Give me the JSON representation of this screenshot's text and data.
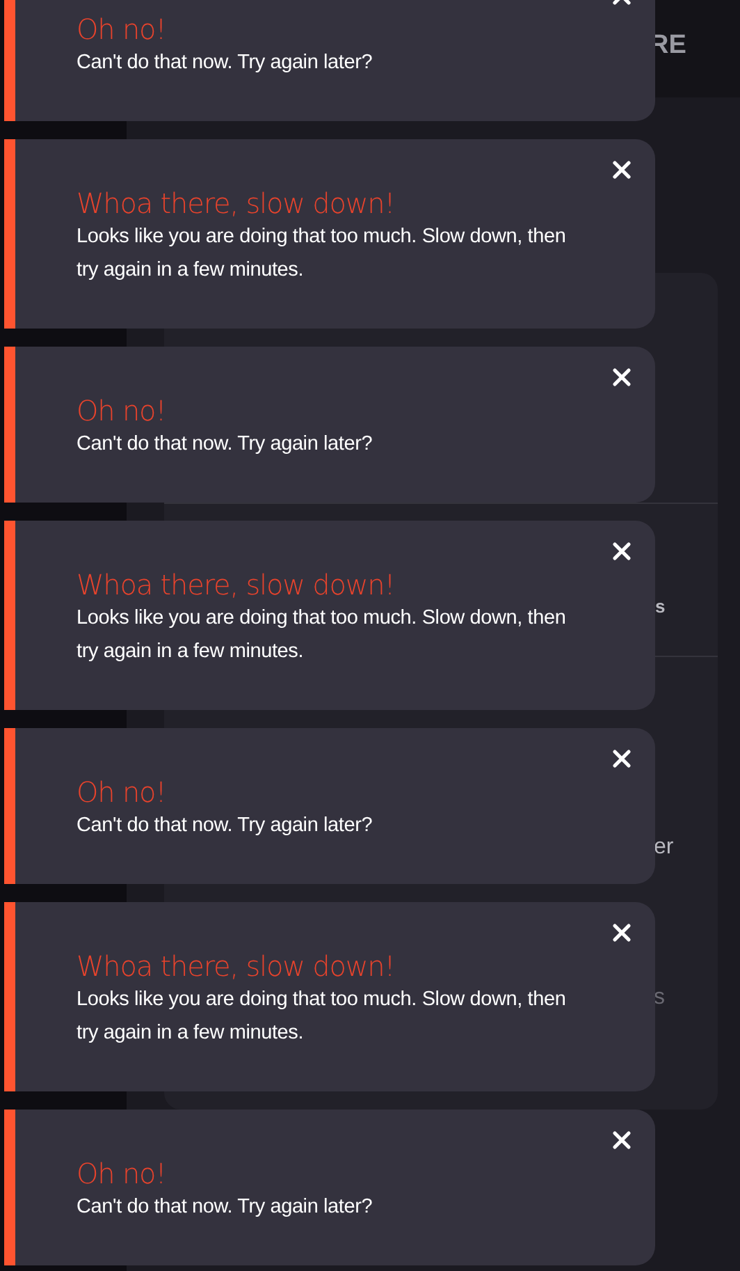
{
  "background": {
    "header_text": "RE",
    "texts": [
      {
        "text": "s"
      },
      {
        "text": "er"
      },
      {
        "text": "s"
      }
    ]
  },
  "toasts": [
    {
      "title": "Oh no!",
      "message": "Can't do that now. Try again later?"
    },
    {
      "title": "Whoa there, slow down!",
      "message": "Looks like you are doing that too much. Slow down, then try again in a few minutes."
    },
    {
      "title": "Oh no!",
      "message": "Can't do that now. Try again later?"
    },
    {
      "title": "Whoa there, slow down!",
      "message": "Looks like you are doing that too much. Slow down, then try again in a few minutes."
    },
    {
      "title": "Oh no!",
      "message": "Can't do that now. Try again later?"
    },
    {
      "title": "Whoa there, slow down!",
      "message": "Looks like you are doing that too much. Slow down, then try again in a few minutes."
    },
    {
      "title": "Oh no!",
      "message": "Can't do that now. Try again later?"
    }
  ]
}
